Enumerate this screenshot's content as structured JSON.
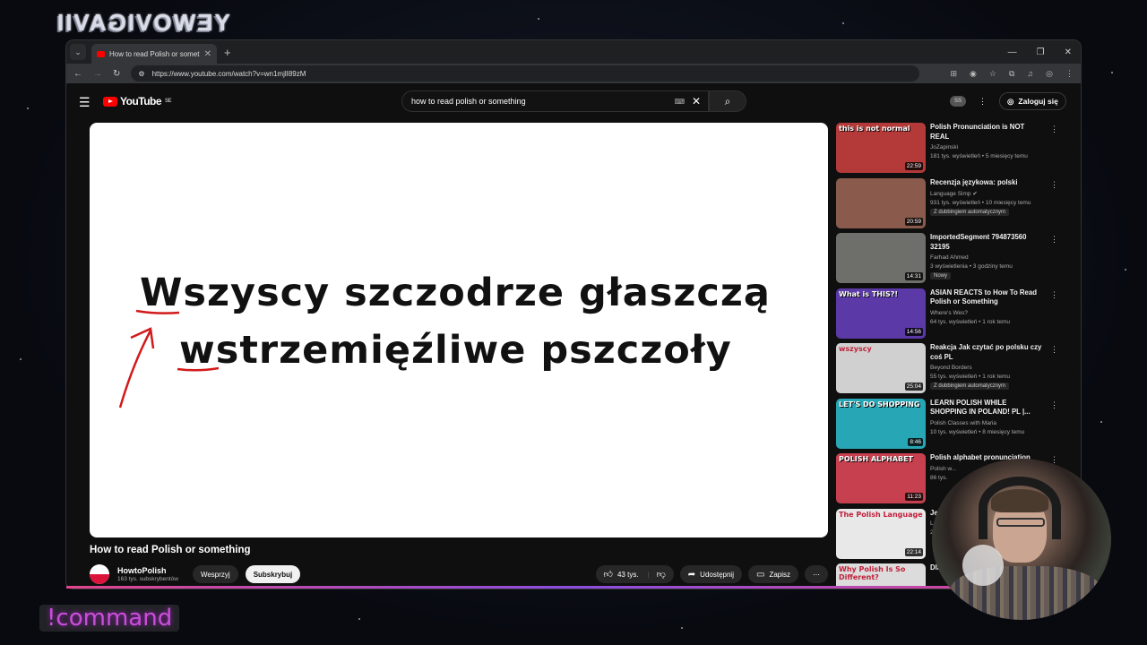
{
  "overlay": {
    "stream_logo": "YEWOVIGAVII",
    "command_label": "!command"
  },
  "browser": {
    "tab_title": "How to read Polish or something",
    "url": "https://www.youtube.com/watch?v=wn1mjlI89zM"
  },
  "youtube": {
    "logo_text": "YouTube",
    "region": "SE",
    "search_query": "how to read polish or something",
    "login_label": "Zaloguj się",
    "avatar_badge": "SS"
  },
  "video": {
    "line1": "Wszyscy szczodrze głaszczą",
    "line2": "wstrzemięźliwe pszczoły",
    "title": "How to read Polish or something",
    "channel_name": "HowtoPolish",
    "channel_subs": "163 tys. subskrybentów",
    "support_label": "Wesprzyj",
    "subscribe_label": "Subskrybuj",
    "like_count": "43 tys.",
    "share_label": "Udostępnij",
    "save_label": "Zapisz"
  },
  "recommendations": [
    {
      "title": "Polish Pronunciation is NOT REAL",
      "channel": "JoZapinski",
      "meta": "181 tys. wyświetleń • 5 miesięcy temu",
      "duration": "22:59",
      "thumb_text": "this is not normal",
      "thumb_color": "#b43a3a",
      "badge": ""
    },
    {
      "title": "Recenzja językowa: polski",
      "channel": "Language Simp ✔",
      "meta": "931 tys. wyświetleń • 10 miesięcy temu",
      "duration": "20:59",
      "thumb_text": "",
      "thumb_color": "#8a5a4c",
      "badge": "Z dubbingiem automatycznym"
    },
    {
      "title": "ImportedSegment 794873560 32195",
      "channel": "Farhad Ahmed",
      "meta": "3 wyświetlenia • 3 godziny temu",
      "duration": "14:31",
      "thumb_text": "",
      "thumb_color": "#6e6e6a",
      "badge": "Nowy"
    },
    {
      "title": "ASIAN REACTS to How To Read Polish or Something",
      "channel": "Where's Wes?",
      "meta": "64 tys. wyświetleń • 1 rok temu",
      "duration": "14:56",
      "thumb_text": "What is THIS?!",
      "thumb_color": "#5b3aa8",
      "badge": ""
    },
    {
      "title": "Reakcja Jak czytać po polsku czy coś PL",
      "channel": "Beyond Borders",
      "meta": "55 tys. wyświetleń • 1 rok temu",
      "duration": "25:04",
      "thumb_text": "wszyscy",
      "thumb_color": "#d0d0d0",
      "badge": "Z dubbingiem automatycznym"
    },
    {
      "title": "LEARN POLISH WHILE SHOPPING IN POLAND! PL |...",
      "channel": "Polish Classes with Maria",
      "meta": "10 tys. wyświetleń • 8 miesięcy temu",
      "duration": "8:46",
      "thumb_text": "LET'S DO SHOPPING",
      "thumb_color": "#27a7b5",
      "badge": ""
    },
    {
      "title": "Polish alphabet pronunciation",
      "channel": "Polish w...",
      "meta": "86 tys.",
      "duration": "11:23",
      "thumb_text": "POLISH ALPHABET",
      "thumb_color": "#c7404f",
      "badge": ""
    },
    {
      "title": "Język",
      "channel": "La...",
      "meta": "2,7",
      "duration": "22:14",
      "thumb_text": "The Polish Language",
      "thumb_color": "#e8e8e8",
      "badge": ""
    },
    {
      "title": "Dlaczego bardzo",
      "channel": "",
      "meta": "",
      "duration": "",
      "thumb_text": "Why Polish Is So Different?",
      "thumb_color": "#dcdcdc",
      "badge": ""
    }
  ]
}
